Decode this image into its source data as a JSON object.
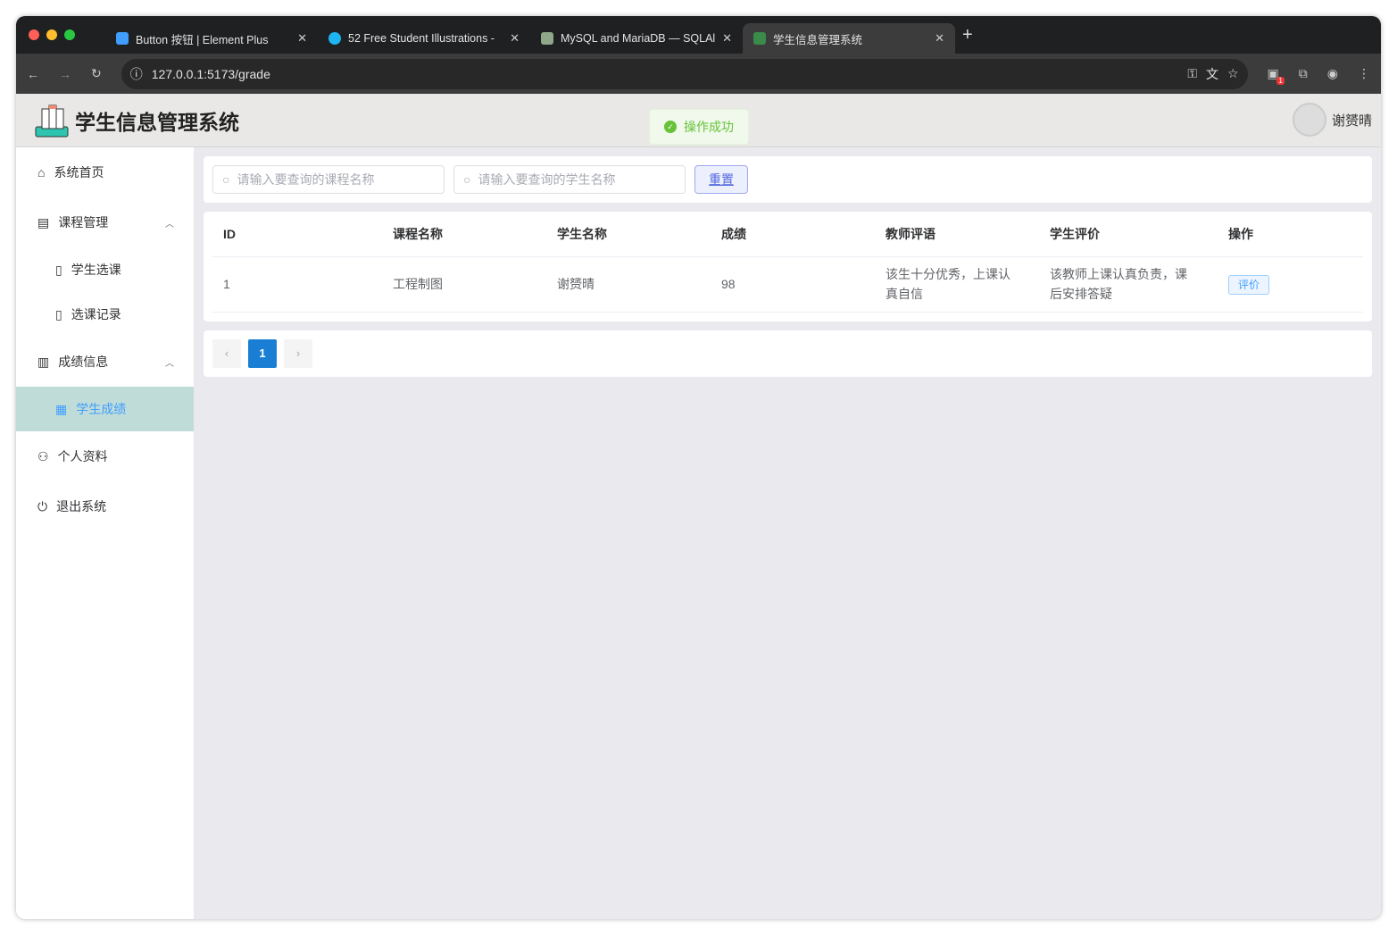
{
  "browser": {
    "tabs": [
      {
        "title": "Button 按钮 | Element Plus",
        "color": "#409eff"
      },
      {
        "title": "52 Free Student Illustrations -",
        "color": "#1eb4f0"
      },
      {
        "title": "MySQL and MariaDB — SQLAlchemy",
        "color": "#8fa88a"
      },
      {
        "title": "学生信息管理系统",
        "color": "#3a8a4a",
        "active": true
      }
    ],
    "url": "127.0.0.1:5173/grade",
    "extension_badge": "1"
  },
  "header": {
    "title": "学生信息管理系统",
    "toast": "操作成功",
    "user": "谢赟晴"
  },
  "sidebar": {
    "items": [
      {
        "label": "系统首页",
        "icon": "home-icon"
      },
      {
        "label": "课程管理",
        "icon": "notebook-icon",
        "expanded": true
      },
      {
        "label": "学生选课",
        "icon": "document-icon"
      },
      {
        "label": "选课记录",
        "icon": "document-icon"
      },
      {
        "label": "成绩信息",
        "icon": "collection-icon",
        "expanded": true
      },
      {
        "label": "学生成绩",
        "icon": "tickets-icon",
        "active": true
      },
      {
        "label": "个人资料",
        "icon": "user-icon"
      },
      {
        "label": "退出系统",
        "icon": "power-icon"
      }
    ]
  },
  "search": {
    "course_placeholder": "请输入要查询的课程名称",
    "student_placeholder": "请输入要查询的学生名称",
    "reset": "重置"
  },
  "table": {
    "columns": [
      "ID",
      "课程名称",
      "学生名称",
      "成绩",
      "教师评语",
      "学生评价",
      "操作"
    ],
    "rows": [
      {
        "id": "1",
        "course": "工程制图",
        "student": "谢赟晴",
        "score": "98",
        "teacher_comment": "该生十分优秀，上课认真自信",
        "student_comment": "该教师上课认真负责，课后安排答疑",
        "action": "评价"
      }
    ]
  },
  "pagination": {
    "current": "1",
    "prev": "‹",
    "next": "›"
  }
}
